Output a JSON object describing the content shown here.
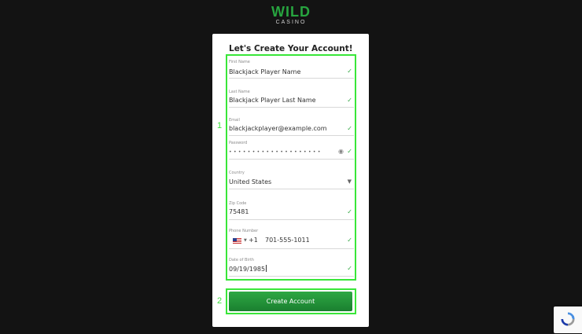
{
  "logo": {
    "main": "WILD",
    "sub": "CASINO"
  },
  "form": {
    "title": "Let's Create Your Account!",
    "first_name": {
      "label": "First Name",
      "value": "Blackjack Player Name"
    },
    "last_name": {
      "label": "Last Name",
      "value": "Blackjack Player Last Name"
    },
    "email": {
      "label": "Email",
      "value": "blackjackplayer@example.com"
    },
    "password": {
      "label": "Password",
      "masked": "••••••••••••••••••••"
    },
    "country": {
      "label": "Country",
      "value": "United States"
    },
    "zip": {
      "label": "Zip Code",
      "value": "75481"
    },
    "phone": {
      "label": "Phone Number",
      "dial_code": "+1",
      "value": "701-555-1011"
    },
    "dob": {
      "label": "Date of Birth",
      "value": "09/19/1985"
    },
    "submit_label": "Create Account"
  },
  "annotations": {
    "marker_1": "1",
    "marker_2": "2",
    "highlight_color": "#39e639"
  },
  "colors": {
    "brand_green": "#27a43f",
    "button_green": "#1e8a34",
    "check_green": "#35a845"
  },
  "icons": {
    "check": "check-icon",
    "caret": "chevron-down-icon",
    "eye": "eye-icon",
    "flag": "us-flag-icon",
    "recaptcha": "recaptcha-icon"
  }
}
